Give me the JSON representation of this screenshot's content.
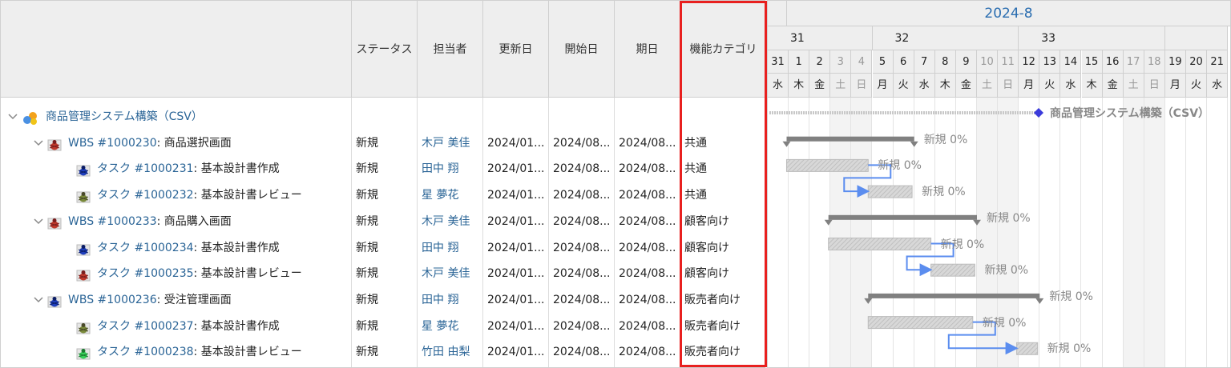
{
  "headers": {
    "status": "ステータス",
    "assignee": "担当者",
    "updated": "更新日",
    "start": "開始日",
    "due": "期日",
    "category": "機能カテゴリ"
  },
  "rows": [
    {
      "indent": 0,
      "chevron": "v",
      "icon": "project-icon",
      "id": "",
      "title": "商品管理システム構築（CSV）",
      "status": "",
      "assignee": "",
      "updated": "",
      "start": "",
      "due": "",
      "category": ""
    },
    {
      "indent": 1,
      "chevron": "v",
      "icon": "wbs-icon",
      "id": "WBS #1000230",
      "title": ": 商品選択画面",
      "status": "新規",
      "assignee": "木戸 美佳",
      "updated": "2024/01...",
      "start": "2024/08...",
      "due": "2024/08...",
      "category": "共通"
    },
    {
      "indent": 2,
      "chevron": "",
      "icon": "task-icon",
      "id": "タスク #1000231",
      "title": ": 基本設計書作成",
      "status": "新規",
      "assignee": "田中 翔",
      "updated": "2024/01...",
      "start": "2024/08...",
      "due": "2024/08...",
      "category": "共通"
    },
    {
      "indent": 2,
      "chevron": "",
      "icon": "review-icon",
      "id": "タスク #1000232",
      "title": ": 基本設計書レビュー",
      "status": "新規",
      "assignee": "星 夢花",
      "updated": "2024/01...",
      "start": "2024/08...",
      "due": "2024/08...",
      "category": "共通"
    },
    {
      "indent": 1,
      "chevron": "v",
      "icon": "wbs-icon",
      "id": "WBS #1000233",
      "title": ": 商品購入画面",
      "status": "新規",
      "assignee": "木戸 美佳",
      "updated": "2024/01...",
      "start": "2024/08...",
      "due": "2024/08...",
      "category": "顧客向け"
    },
    {
      "indent": 2,
      "chevron": "",
      "icon": "task-icon",
      "id": "タスク #1000234",
      "title": ": 基本設計書作成",
      "status": "新規",
      "assignee": "田中 翔",
      "updated": "2024/01...",
      "start": "2024/08...",
      "due": "2024/08...",
      "category": "顧客向け"
    },
    {
      "indent": 2,
      "chevron": "",
      "icon": "wbs-icon",
      "id": "タスク #1000235",
      "title": ": 基本設計書レビュー",
      "status": "新規",
      "assignee": "木戸 美佳",
      "updated": "2024/01...",
      "start": "2024/08...",
      "due": "2024/08...",
      "category": "顧客向け"
    },
    {
      "indent": 1,
      "chevron": "v",
      "icon": "task-icon",
      "id": "WBS #1000236",
      "title": ": 受注管理画面",
      "status": "新規",
      "assignee": "田中 翔",
      "updated": "2024/01...",
      "start": "2024/08...",
      "due": "2024/08...",
      "category": "販売者向け"
    },
    {
      "indent": 2,
      "chevron": "",
      "icon": "review-icon",
      "id": "タスク #1000237",
      "title": ": 基本設計書作成",
      "status": "新規",
      "assignee": "星 夢花",
      "updated": "2024/01...",
      "start": "2024/08...",
      "due": "2024/08...",
      "category": "販売者向け"
    },
    {
      "indent": 2,
      "chevron": "",
      "icon": "green-icon",
      "id": "タスク #1000238",
      "title": ": 基本設計書レビュー",
      "status": "新規",
      "assignee": "竹田 由梨",
      "updated": "2024/01...",
      "start": "2024/08...",
      "due": "2024/08...",
      "category": "販売者向け"
    }
  ],
  "gantt": {
    "month": "2024-8",
    "weeks": [
      "31",
      "32",
      "33"
    ],
    "days": [
      "31",
      "1",
      "2",
      "3",
      "4",
      "5",
      "6",
      "7",
      "8",
      "9",
      "10",
      "11",
      "12",
      "13",
      "14",
      "15",
      "16",
      "17",
      "18",
      "19",
      "20",
      "21"
    ],
    "weekdays": [
      "水",
      "木",
      "金",
      "土",
      "日",
      "月",
      "火",
      "水",
      "木",
      "金",
      "土",
      "日",
      "月",
      "火",
      "水",
      "木",
      "金",
      "土",
      "日",
      "月",
      "火",
      "水"
    ],
    "weekend_indices": [
      3,
      4,
      10,
      11,
      17,
      18
    ],
    "project_label": "商品管理システム構築（CSV）",
    "bar_labels": [
      "新規 0%",
      "新規 0%",
      "新規 0%",
      "新規 0%",
      "新規 0%",
      "新規 0%",
      "新規 0%",
      "新規 0%",
      "新規 0%"
    ]
  },
  "colors": {
    "highlight": "#e8201f",
    "link": "#2a6496",
    "header_bg": "#eeeeee",
    "parent_bar": "#808080",
    "relation": "#5b8def"
  }
}
